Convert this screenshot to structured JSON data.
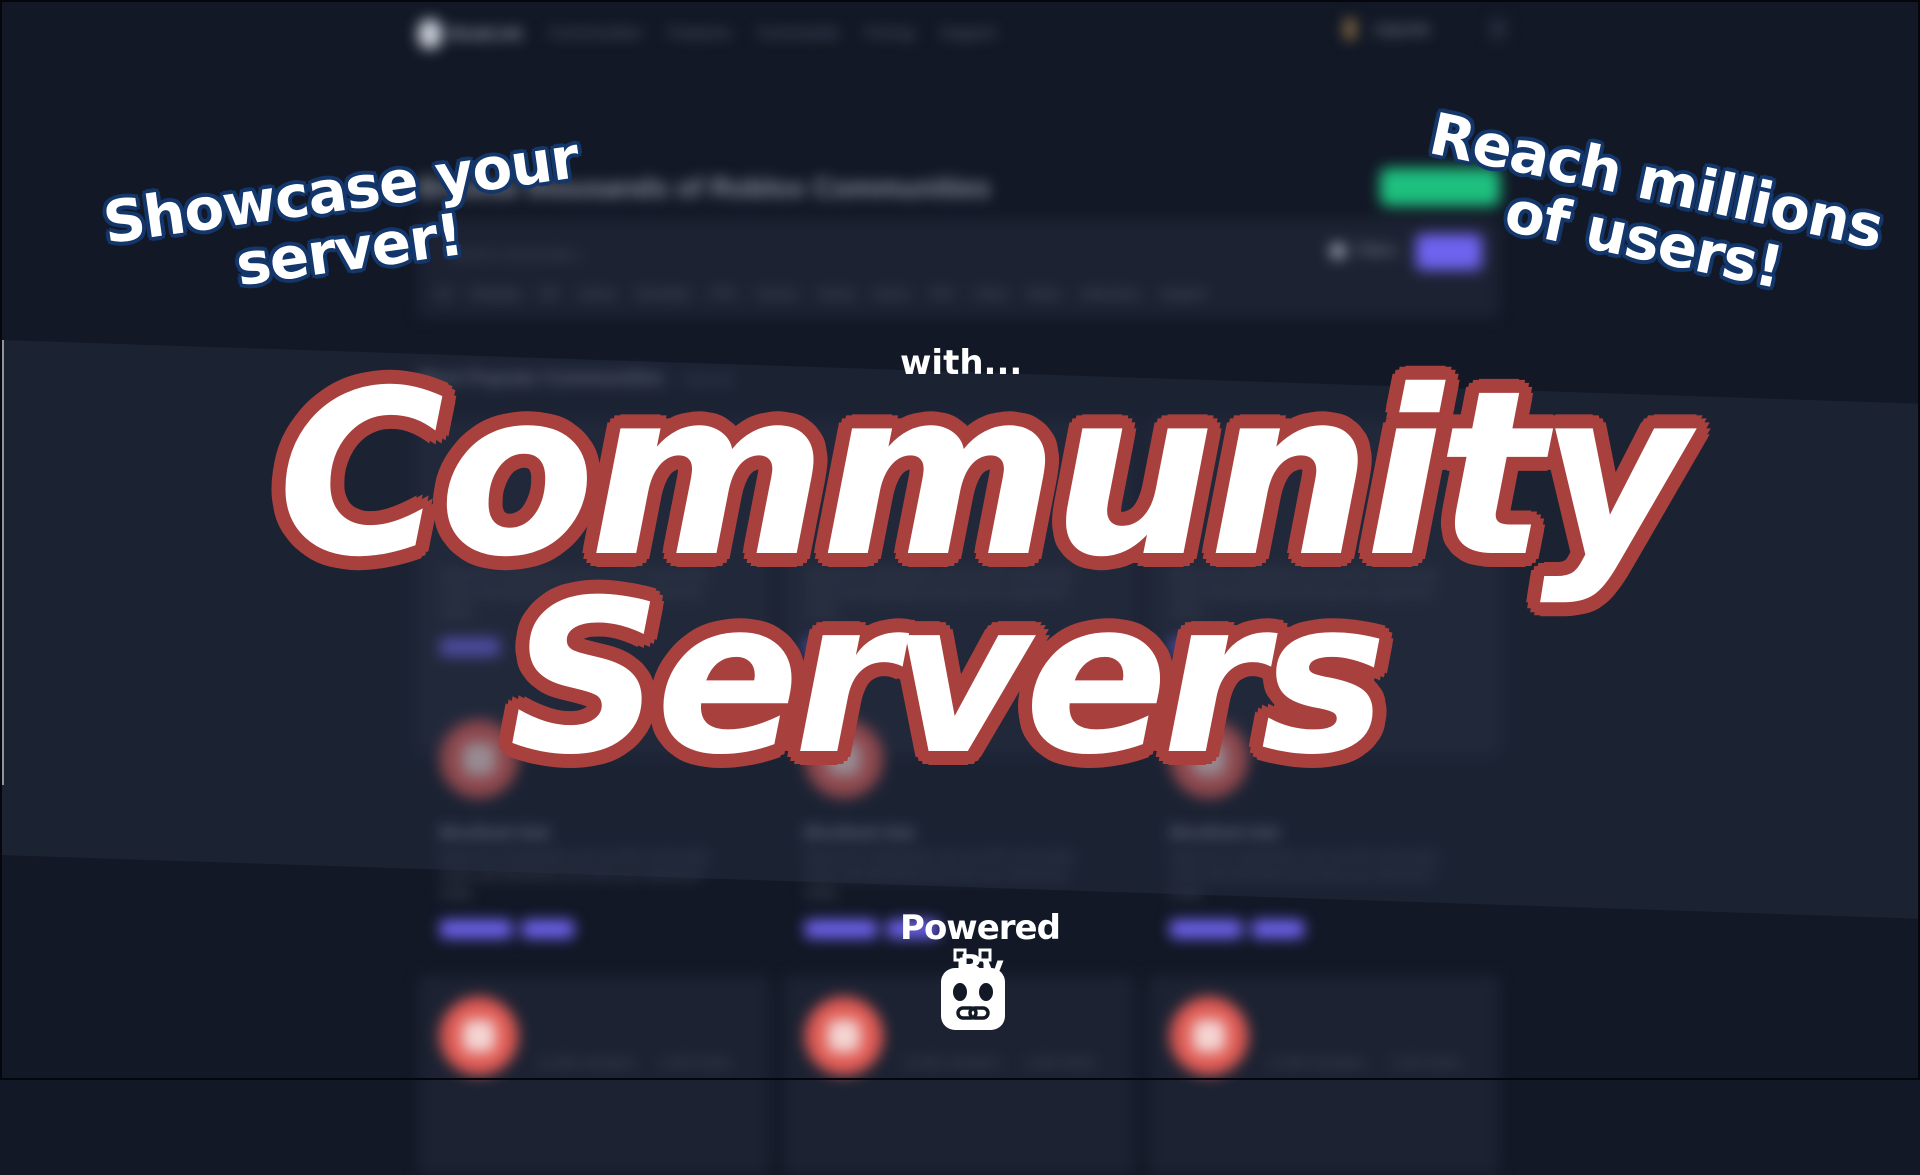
{
  "background_site": {
    "brand": "BoatLink",
    "nav_links": [
      "Communities",
      "Features",
      "Commands",
      "Pricing",
      "Support"
    ],
    "user_label": "Upgrade",
    "hero_title": "Browse thousands of Roblox Communities",
    "search_placeholder": "Search communities...",
    "filter_label": "Filters",
    "search_button": "Search",
    "tags": [
      "All",
      "Roleplay",
      "RP",
      "Anime",
      "Simulator",
      "FPS",
      "Tycoon",
      "Social",
      "Horror",
      "PvP",
      "Clans",
      "Music",
      "Adventure",
      "Support"
    ],
    "section_title": "Most Popular Communities",
    "section_sub": "View all",
    "cards": [
      {
        "title": "BloxRank Hub",
        "description": "Welcome to BloxRank, join our RP community! Verify with BloxRank and start your adventure today.",
        "button1": "Join Server",
        "button2": "Details"
      },
      {
        "title": "BloxRank Hub",
        "description": "Welcome to BloxRank, join our RP community! Verify with BloxRank and start your adventure today.",
        "button1": "Join Server",
        "button2": "Details"
      },
      {
        "title": "BloxRank Hub",
        "description": "Welcome to BloxRank, join our RP community! Verify with BloxRank and start your adventure today.",
        "button1": "Join Server",
        "button2": "Details"
      }
    ],
    "bottom_cards": [
      {
        "members": "12,481 members",
        "online": "1,203 online"
      },
      {
        "members": "12,481 members",
        "online": "1,203 online"
      },
      {
        "members": "12,481 members",
        "online": "1,203 online"
      }
    ]
  },
  "overlay": {
    "left_callout": [
      "Showcase your",
      "server!"
    ],
    "right_callout": [
      "Reach millions",
      "of users!"
    ],
    "with_text": "with...",
    "title_line1": "Community",
    "title_line2": "Servers",
    "powered_by": "Powered By",
    "logo_icon": "robot-link-icon"
  },
  "colors": {
    "background": "#121826",
    "title_outline": "#a8413e",
    "callout_outline": "#13366b",
    "accent_purple": "#6e63f0",
    "accent_green": "#1ec07f"
  }
}
